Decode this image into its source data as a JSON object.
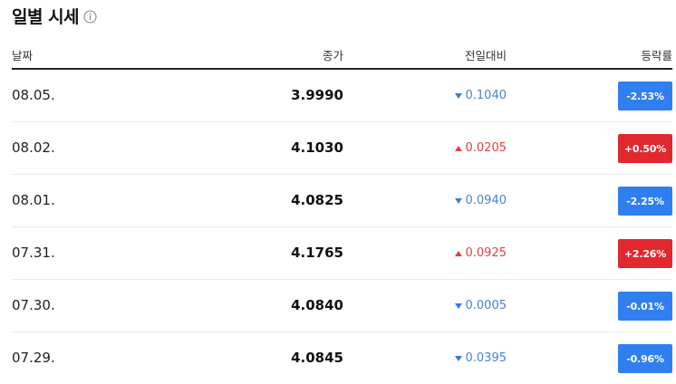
{
  "title": "일별 시세",
  "icons": {
    "info": "info-icon"
  },
  "colors": {
    "down": "#2f7ff0",
    "up": "#e0282e"
  },
  "columns": {
    "date": "날짜",
    "close": "종가",
    "change": "전일대비",
    "rate": "등락률"
  },
  "rows": [
    {
      "date": "08.05.",
      "close": "3.9990",
      "direction": "down",
      "change": "0.1040",
      "rate": "-2.53%"
    },
    {
      "date": "08.02.",
      "close": "4.1030",
      "direction": "up",
      "change": "0.0205",
      "rate": "+0.50%"
    },
    {
      "date": "08.01.",
      "close": "4.0825",
      "direction": "down",
      "change": "0.0940",
      "rate": "-2.25%"
    },
    {
      "date": "07.31.",
      "close": "4.1765",
      "direction": "up",
      "change": "0.0925",
      "rate": "+2.26%"
    },
    {
      "date": "07.30.",
      "close": "4.0840",
      "direction": "down",
      "change": "0.0005",
      "rate": "-0.01%"
    },
    {
      "date": "07.29.",
      "close": "4.0845",
      "direction": "down",
      "change": "0.0395",
      "rate": "-0.96%"
    }
  ]
}
